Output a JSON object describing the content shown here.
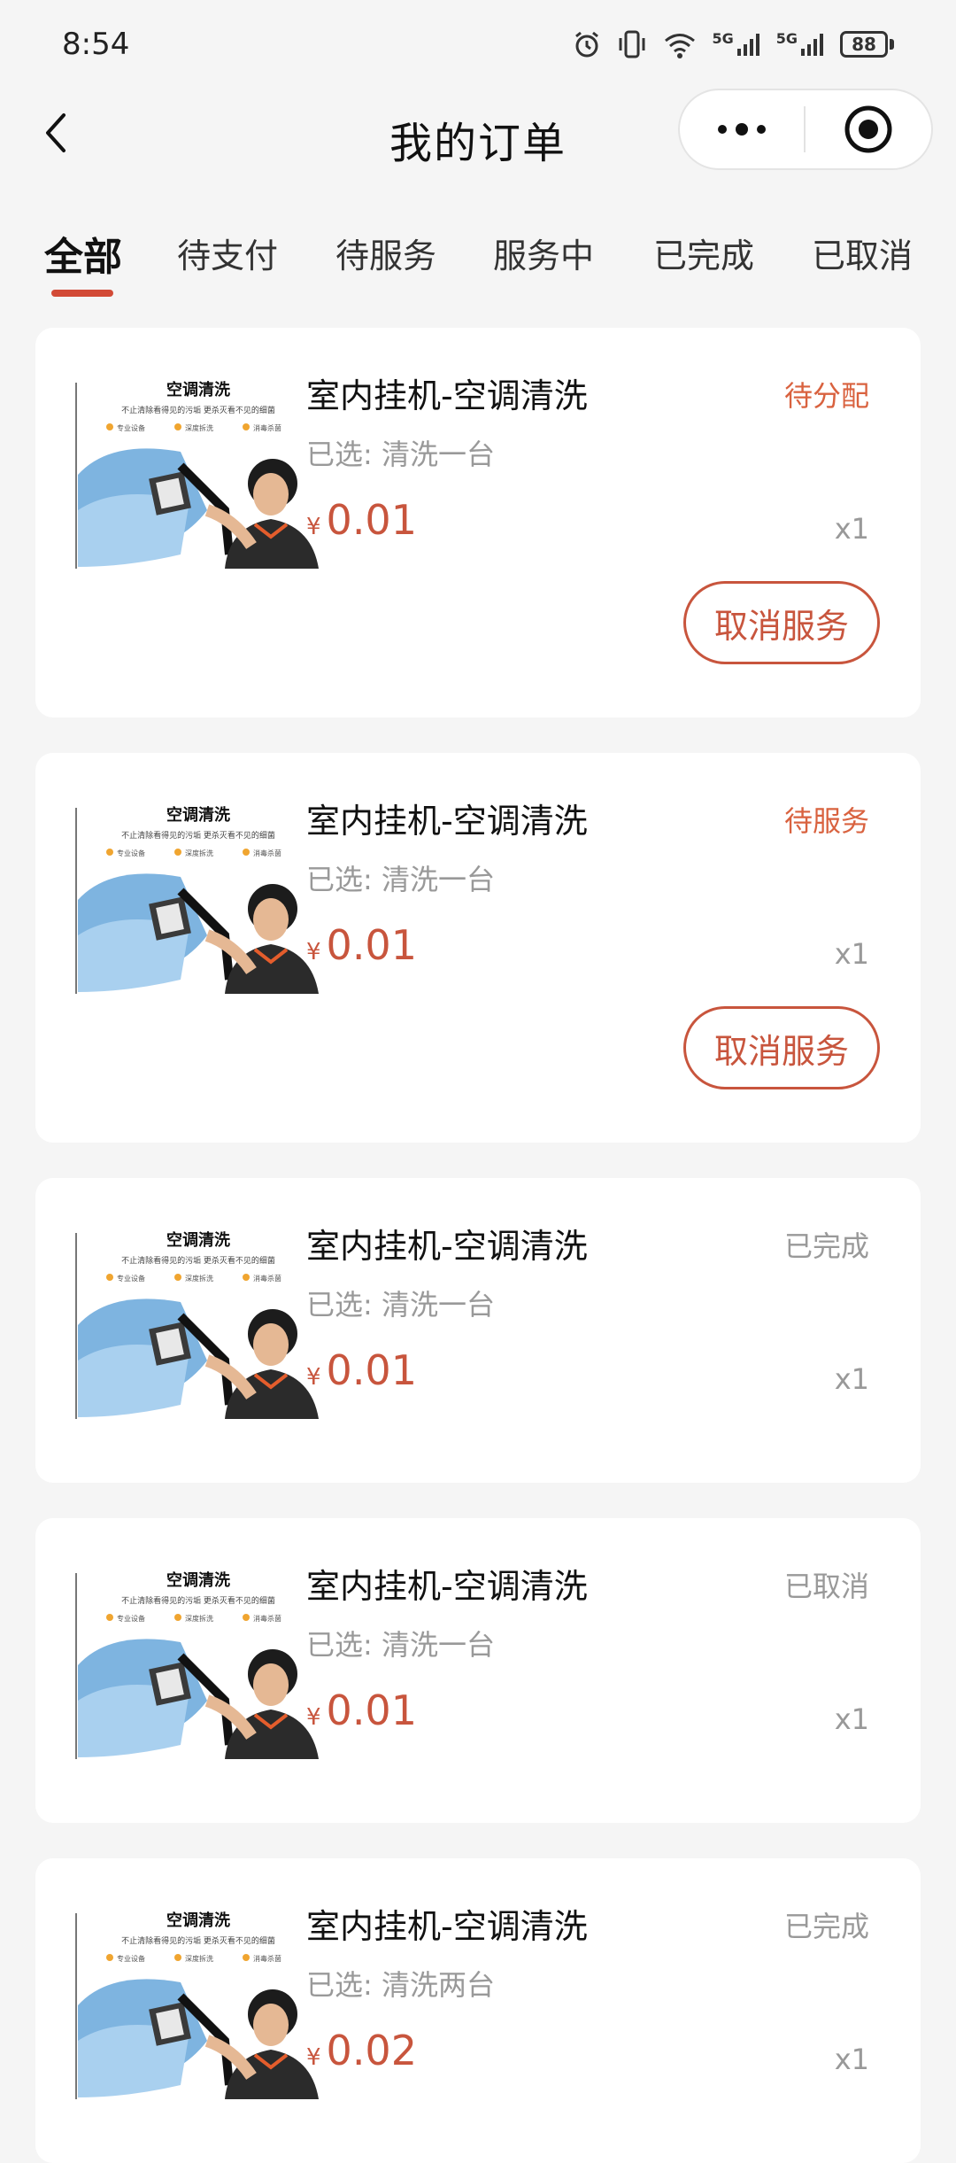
{
  "status_bar": {
    "time": "8:54",
    "signal_1": "5G",
    "signal_2": "5G",
    "battery": "88"
  },
  "nav": {
    "title": "我的订单"
  },
  "tabs": [
    {
      "label": "全部",
      "active": true
    },
    {
      "label": "待支付",
      "active": false
    },
    {
      "label": "待服务",
      "active": false
    },
    {
      "label": "服务中",
      "active": false
    },
    {
      "label": "已完成",
      "active": false
    },
    {
      "label": "已取消",
      "active": false
    }
  ],
  "orders": [
    {
      "thumb": {
        "title": "空调清洗",
        "subtitle": "不止清除看得见的污垢 更杀灭看不见的细菌",
        "tag_1": "专业设备",
        "tag_2": "深度拆洗",
        "tag_3": "消毒杀菌"
      },
      "title": "室内挂机-空调清洗",
      "status": "待分配",
      "status_style": "accent",
      "spec": "已选: 清洗一台",
      "currency": "¥",
      "price": "0.01",
      "qty": "x1",
      "action": "取消服务"
    },
    {
      "thumb": {
        "title": "空调清洗",
        "subtitle": "不止清除看得见的污垢 更杀灭看不见的细菌",
        "tag_1": "专业设备",
        "tag_2": "深度拆洗",
        "tag_3": "消毒杀菌"
      },
      "title": "室内挂机-空调清洗",
      "status": "待服务",
      "status_style": "accent",
      "spec": "已选: 清洗一台",
      "currency": "¥",
      "price": "0.01",
      "qty": "x1",
      "action": "取消服务"
    },
    {
      "thumb": {
        "title": "空调清洗",
        "subtitle": "不止清除看得见的污垢 更杀灭看不见的细菌",
        "tag_1": "专业设备",
        "tag_2": "深度拆洗",
        "tag_3": "消毒杀菌"
      },
      "title": "室内挂机-空调清洗",
      "status": "已完成",
      "status_style": "muted",
      "spec": "已选: 清洗一台",
      "currency": "¥",
      "price": "0.01",
      "qty": "x1"
    },
    {
      "thumb": {
        "title": "空调清洗",
        "subtitle": "不止清除看得见的污垢 更杀灭看不见的细菌",
        "tag_1": "专业设备",
        "tag_2": "深度拆洗",
        "tag_3": "消毒杀菌"
      },
      "title": "室内挂机-空调清洗",
      "status": "已取消",
      "status_style": "muted",
      "spec": "已选: 清洗一台",
      "currency": "¥",
      "price": "0.01",
      "qty": "x1"
    },
    {
      "thumb": {
        "title": "空调清洗",
        "subtitle": "不止清除看得见的污垢 更杀灭看不见的细菌",
        "tag_1": "专业设备",
        "tag_2": "深度拆洗",
        "tag_3": "消毒杀菌"
      },
      "title": "室内挂机-空调清洗",
      "status": "已完成",
      "status_style": "muted",
      "spec": "已选: 清洗两台",
      "currency": "¥",
      "price": "0.02",
      "qty": "x1"
    }
  ],
  "colors": {
    "accent": "#c8553d",
    "status_accent": "#d9623f",
    "muted": "#999999",
    "background": "#f5f5f5"
  },
  "icons": [
    "back-arrow-icon",
    "more-dots-icon",
    "close-target-icon",
    "alarm-icon",
    "vibrate-icon",
    "wifi-icon",
    "signal-icon",
    "battery-icon"
  ]
}
